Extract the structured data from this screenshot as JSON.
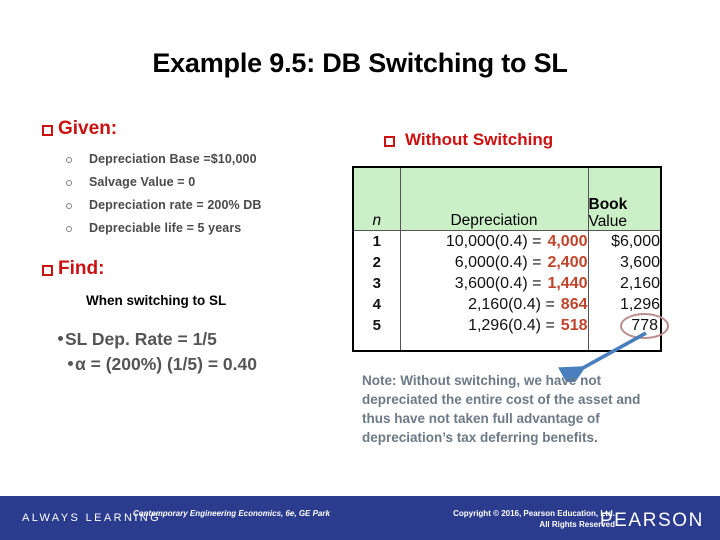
{
  "slide": {
    "title": "Example 9.5: DB Switching to SL"
  },
  "given": {
    "heading": "Given:",
    "items": [
      "Depreciation Base =$10,000",
      "Salvage Value = 0",
      "Depreciation rate = 200% DB",
      "Depreciable life = 5 years"
    ]
  },
  "find": {
    "heading": "Find:",
    "subtitle": "When switching to SL",
    "formulas": [
      "SL Dep. Rate = 1/5",
      "α = (200%) (1/5) = 0.40"
    ]
  },
  "without_switching": {
    "heading": "Without Switching",
    "table": {
      "headers": {
        "n": "n",
        "depreciation": "Depreciation",
        "book_value_line1": "Book",
        "book_value_line2": "Value"
      },
      "rows": [
        {
          "n": "1",
          "expr": "10,000(0.4) =",
          "result": "4,000",
          "book_value": "$6,000",
          "circled": false
        },
        {
          "n": "2",
          "expr": "6,000(0.4) =",
          "result": "2,400",
          "book_value": "3,600",
          "circled": false
        },
        {
          "n": "3",
          "expr": "3,600(0.4) =",
          "result": "1,440",
          "book_value": "2,160",
          "circled": false
        },
        {
          "n": "4",
          "expr": "2,160(0.4) =",
          "result": "864",
          "book_value": "1,296",
          "circled": false
        },
        {
          "n": "5",
          "expr": "1,296(0.4) =",
          "result": "518",
          "book_value": "778",
          "circled": true
        }
      ]
    }
  },
  "note": {
    "text": "Note: Without switching, we have not depreciated the entire cost of the asset and thus have not taken full advantage of depreciation’s tax deferring benefits."
  },
  "footer": {
    "always_learning": "ALWAYS LEARNING",
    "book_credit": "Contemporary Engineering Economics, 6e, GE Park",
    "copyright_line1": "Copyright © 2016, Pearson Education, Ltd.",
    "copyright_line2": "All Rights Reserved",
    "brand": "PEARSON"
  },
  "colors": {
    "heading_red": "#cc1111",
    "table_header_green": "#cbf0c8",
    "result_orange": "#c0442a",
    "note_gray": "#6b7a86",
    "footer_blue": "#2b3c8e",
    "circle_rose": "#bb8d8d",
    "arrow_blue": "#4a7fbf"
  }
}
